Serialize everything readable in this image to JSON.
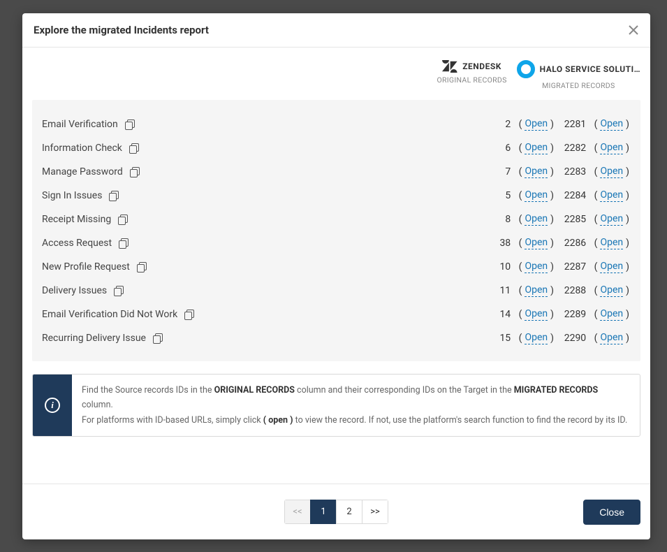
{
  "modal": {
    "title": "Explore the migrated Incidents report",
    "close_label": "Close"
  },
  "platforms": {
    "original": {
      "name": "ZENDESK",
      "sub": "ORIGINAL RECORDS"
    },
    "migrated": {
      "name": "HALO SERVICE SOLUTI…",
      "sub": "MIGRATED RECORDS"
    }
  },
  "open_label": "Open",
  "rows": [
    {
      "name": "Email Verification",
      "orig_id": "2",
      "mig_id": "2281"
    },
    {
      "name": "Information Check",
      "orig_id": "6",
      "mig_id": "2282"
    },
    {
      "name": "Manage Password",
      "orig_id": "7",
      "mig_id": "2283"
    },
    {
      "name": "Sign In Issues",
      "orig_id": "5",
      "mig_id": "2284"
    },
    {
      "name": "Receipt Missing",
      "orig_id": "8",
      "mig_id": "2285"
    },
    {
      "name": "Access Request",
      "orig_id": "38",
      "mig_id": "2286"
    },
    {
      "name": "New Profile Request",
      "orig_id": "10",
      "mig_id": "2287"
    },
    {
      "name": "Delivery Issues",
      "orig_id": "11",
      "mig_id": "2288"
    },
    {
      "name": "Email Verification Did Not Work",
      "orig_id": "14",
      "mig_id": "2289"
    },
    {
      "name": "Recurring Delivery Issue",
      "orig_id": "15",
      "mig_id": "2290"
    }
  ],
  "info": {
    "p1_a": "Find the Source records IDs in the ",
    "p1_b": "ORIGINAL RECORDS",
    "p1_c": " column and their corresponding IDs on the Target in the ",
    "p1_d": "MIGRATED RECORDS",
    "p1_e": " column.",
    "p2_a": "For platforms with ID-based URLs, simply click ",
    "p2_b": "( open )",
    "p2_c": " to view the record. If not, use the platform's search function to find the record by its ID."
  },
  "pagination": {
    "prev": "<<",
    "pages": [
      "1",
      "2"
    ],
    "active": 0,
    "next": ">>"
  }
}
